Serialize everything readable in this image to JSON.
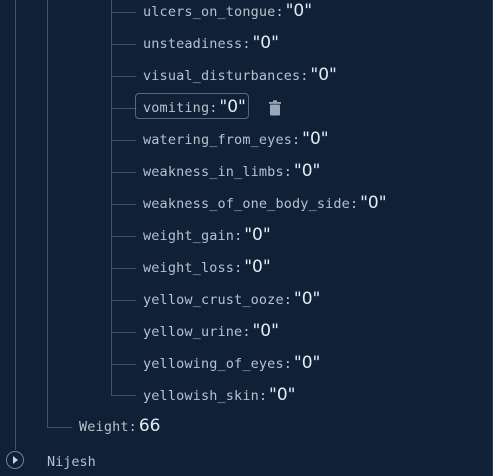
{
  "fields": [
    {
      "key": "ulcers_on_tongue",
      "value": "\"0\""
    },
    {
      "key": "unsteadiness",
      "value": "\"0\""
    },
    {
      "key": "visual_disturbances",
      "value": "\"0\""
    },
    {
      "key": "vomiting",
      "value": "\"0\""
    },
    {
      "key": "watering_from_eyes",
      "value": "\"0\""
    },
    {
      "key": "weakness_in_limbs",
      "value": "\"0\""
    },
    {
      "key": "weakness_of_one_body_side",
      "value": "\"0\""
    },
    {
      "key": "weight_gain",
      "value": "\"0\""
    },
    {
      "key": "weight_loss",
      "value": "\"0\""
    },
    {
      "key": "yellow_crust_ooze",
      "value": "\"0\""
    },
    {
      "key": "yellow_urine",
      "value": "\"0\""
    },
    {
      "key": "yellowing_of_eyes",
      "value": "\"0\""
    },
    {
      "key": "yellowish_skin",
      "value": "\"0\""
    }
  ],
  "colon": ":",
  "weight": {
    "key": "Weight",
    "value": "66"
  },
  "next_node": {
    "label": "Nijesh"
  },
  "icons": {
    "delete": "trash-icon",
    "expand": "chevron-right-icon"
  }
}
